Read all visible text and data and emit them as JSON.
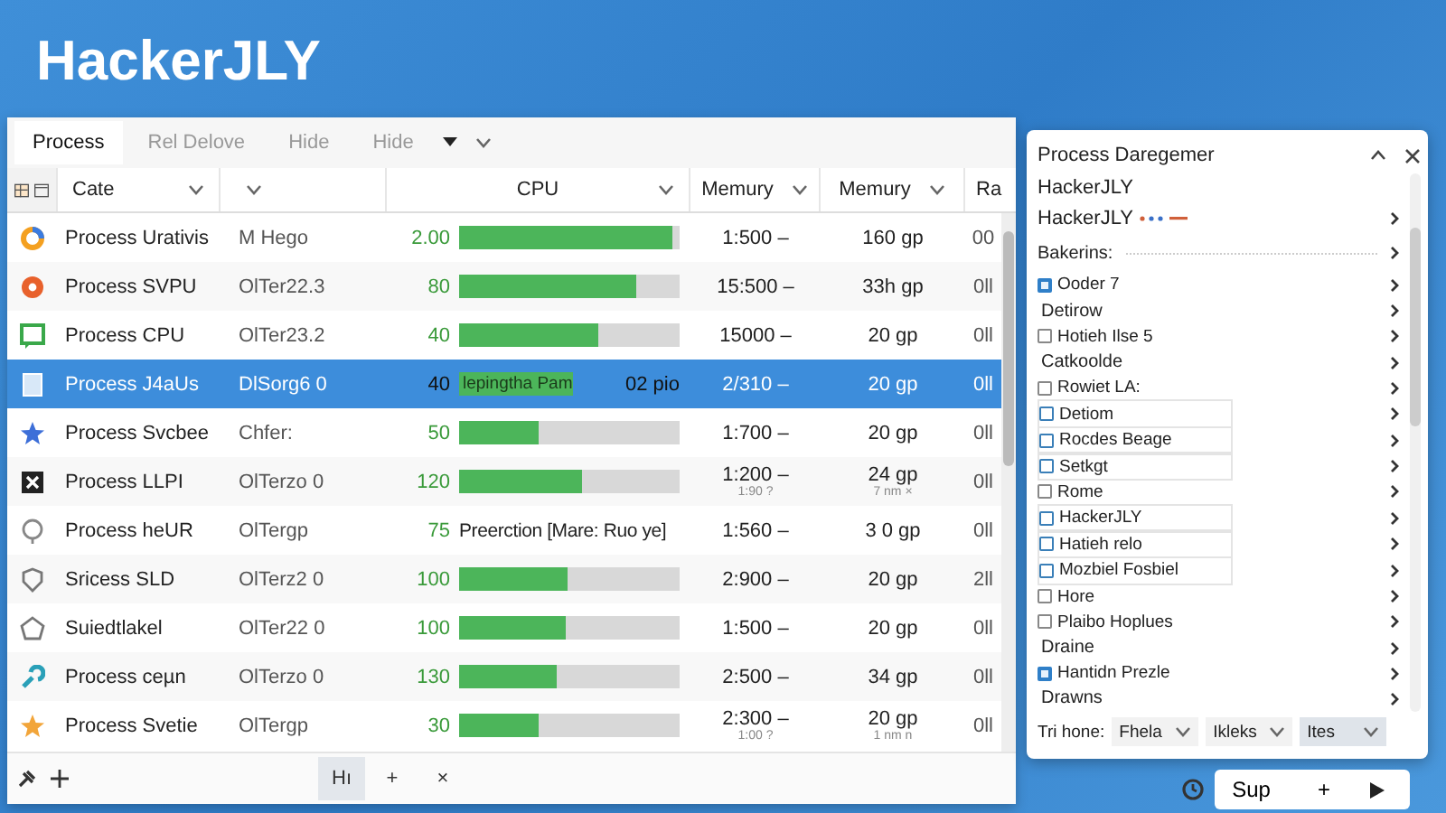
{
  "app_title": "HackerJLY",
  "menu": [
    {
      "label": "Process",
      "selected": true
    },
    {
      "label": "Rel Delove",
      "selected": false
    },
    {
      "label": "Hide",
      "selected": false
    },
    {
      "label": "Hide",
      "selected": false,
      "dropdown": true
    }
  ],
  "columns": [
    {
      "label": "Cate",
      "chevron": true
    },
    {
      "chevron": true
    },
    {
      "label": "CPU",
      "chevron": true
    },
    {
      "label": "Memury",
      "chevron": true
    },
    {
      "label": "Memury",
      "chevron": true
    },
    {
      "label": "Ra",
      "chevron": false
    }
  ],
  "rows": [
    {
      "name": "Process Urativis",
      "detail": "M Hego",
      "cpu": "2.00",
      "kind": "bar",
      "level": 0.97,
      "mem1": "1:500 –",
      "mem2": "160 gp",
      "ra": "00",
      "selected": false
    },
    {
      "name": "Process SVPU",
      "detail": "OlTer22.3",
      "cpu": "80",
      "kind": "bar",
      "level": 0.8,
      "mem1": "15:500 –",
      "mem2": "33h gp",
      "ra": "0ll",
      "selected": false
    },
    {
      "name": "Process CPU",
      "detail": "OlTer23.2",
      "cpu": "40",
      "kind": "bar",
      "level": 0.63,
      "mem1": "15000 –",
      "mem2": "20 gp",
      "ra": "0ll",
      "selected": false
    },
    {
      "name": "Process J4aUs",
      "detail": "DlSorg6 0",
      "cpu": "40",
      "kind": "labeled-bar",
      "level": 0.52,
      "bar_label": "lepingtha Pam",
      "bar_reading": "02 pio",
      "mem1": "2/310 –",
      "mem2": "20 gp",
      "ra": "0ll",
      "selected": true
    },
    {
      "name": "Process Svcbee",
      "detail": "Chfer:",
      "cpu": "50",
      "kind": "bar",
      "level": 0.36,
      "mem1": "1:700 –",
      "mem2": "20 gp",
      "ra": "0ll",
      "selected": false
    },
    {
      "name": "Process LLPI",
      "detail": "OlTerzo 0",
      "cpu": "120",
      "kind": "bar",
      "level": 0.56,
      "mem1": "1:200 –",
      "mem1_sub": "1:90 ?",
      "mem2": "24 gp",
      "mem2_sub": "7 nm ×",
      "ra": "0ll",
      "selected": false
    },
    {
      "name": "Process heUR",
      "detail": "OlTergp",
      "cpu": "75",
      "kind": "text",
      "note": "Preerction [Mare: Ruo ye]",
      "mem1": "1:560 –",
      "mem2": "3 0 gp",
      "ra": "0ll",
      "selected": false
    },
    {
      "name": "Sricess SLD",
      "detail": "OlTerz2 0",
      "cpu": "100",
      "kind": "bar",
      "level": 0.49,
      "mem1": "2:900 –",
      "mem2": "20 gp",
      "ra": "2ll",
      "selected": false
    },
    {
      "name": "Suiedtlakel",
      "detail": "OlTer22 0",
      "cpu": "100",
      "kind": "bar",
      "level": 0.48,
      "mem1": "1:500 –",
      "mem2": "20 gp",
      "ra": "0ll",
      "selected": false
    },
    {
      "name": "Process ceµn",
      "detail": "OlTerzo 0",
      "cpu": "130",
      "kind": "bar",
      "level": 0.44,
      "mem1": "2:500 –",
      "mem2": "34 gp",
      "ra": "0ll",
      "selected": false
    },
    {
      "name": "Process Svetie",
      "detail": "OlTergp",
      "cpu": "30",
      "kind": "bar",
      "level": 0.36,
      "mem1": "2:300 –",
      "mem1_sub": "1:00 ?",
      "mem2": "20 gp",
      "mem2_sub": "1 nm n",
      "ra": "0ll",
      "selected": false
    }
  ],
  "bottom_buttons": [
    {
      "label": "Hı",
      "selected": true
    },
    {
      "label": "+",
      "selected": false
    },
    {
      "label": "×",
      "selected": false
    }
  ],
  "panel": {
    "title": "Process Daregemer",
    "items": [
      {
        "kind": "heading",
        "label": "HackerJLY"
      },
      {
        "kind": "heading",
        "label": "HackerJLY",
        "dots": true
      },
      {
        "kind": "section",
        "label": "Bakerins:"
      },
      {
        "kind": "check",
        "label": "Ooder 7",
        "checked": true,
        "boxed": false
      },
      {
        "kind": "plain",
        "label": "Detirow"
      },
      {
        "kind": "check",
        "label": "Hotieh Ilse 5",
        "checked": false,
        "boxed": false
      },
      {
        "kind": "plain",
        "label": "Catkoolde"
      },
      {
        "kind": "check",
        "label": "Rowiet LA:",
        "checked": false,
        "boxed": false
      },
      {
        "kind": "check",
        "label": "Detiom",
        "checked": false,
        "boxed": true
      },
      {
        "kind": "check",
        "label": "Rocdes Beage",
        "checked": false,
        "boxed": true
      },
      {
        "kind": "check",
        "label": "Setkgt",
        "checked": false,
        "boxed": true
      },
      {
        "kind": "check",
        "label": "Rome",
        "checked": false,
        "boxed": false
      },
      {
        "kind": "check",
        "label": "HackerJLY",
        "checked": false,
        "boxed": true
      },
      {
        "kind": "check",
        "label": "Hatieh relo",
        "checked": false,
        "boxed": true
      },
      {
        "kind": "check",
        "label": "Mozbiel Fosbiel",
        "checked": false,
        "boxed": true
      },
      {
        "kind": "check",
        "label": "Hore",
        "checked": false,
        "boxed": false
      },
      {
        "kind": "check",
        "label": "Plaibo Hoplues",
        "checked": false,
        "boxed": false
      },
      {
        "kind": "plain",
        "label": "Draine"
      },
      {
        "kind": "check",
        "label": "Hantidn Prezle",
        "checked": true,
        "boxed": false
      },
      {
        "kind": "plain",
        "label": "Drawns"
      }
    ],
    "footer_label": "Tri hone:",
    "dropdowns": [
      {
        "value": "Fhela",
        "selected": false
      },
      {
        "value": "Ikleks",
        "selected": false
      },
      {
        "value": "Ites",
        "selected": true
      }
    ]
  },
  "action_bar": {
    "button": "Sup",
    "plus": "+"
  }
}
